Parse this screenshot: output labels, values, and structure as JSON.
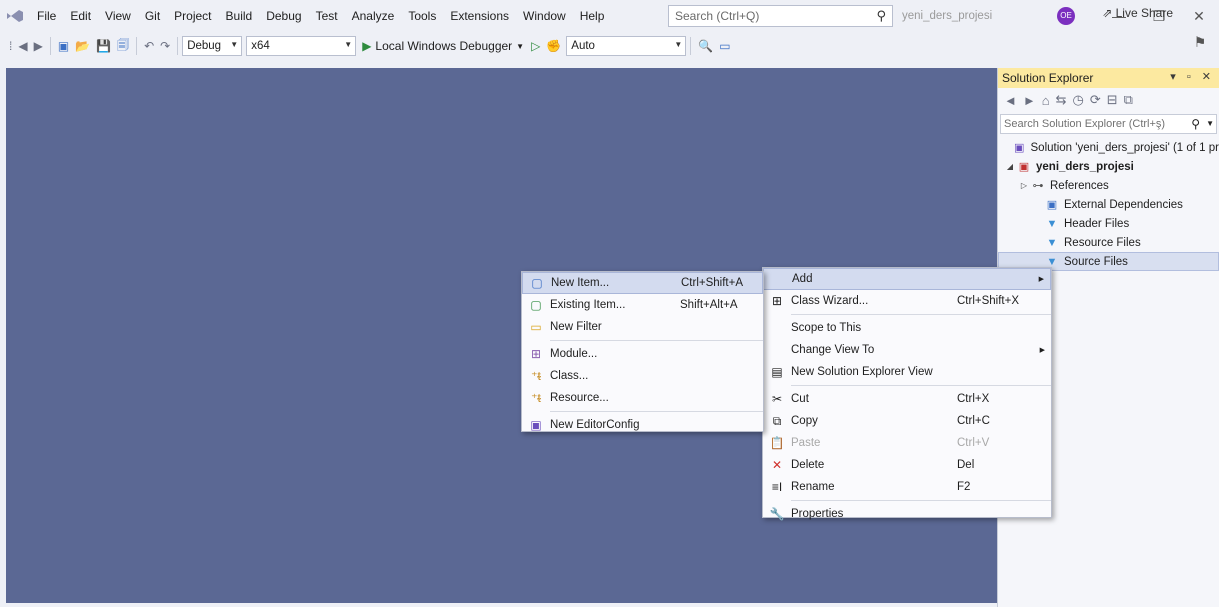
{
  "menubar": {
    "items": [
      "File",
      "Edit",
      "View",
      "Git",
      "Project",
      "Build",
      "Debug",
      "Test",
      "Analyze",
      "Tools",
      "Extensions",
      "Window",
      "Help"
    ],
    "search_placeholder": "Search (Ctrl+Q)",
    "solution_name": "yeni_ders_projesi",
    "avatar_initials": "OE"
  },
  "toolbar": {
    "config": "Debug",
    "platform": "x64",
    "debugger_label": "Local Windows Debugger",
    "target": "Auto",
    "live_share": "Live Share"
  },
  "solution_explorer": {
    "title": "Solution Explorer",
    "search_placeholder": "Search Solution Explorer (Ctrl+ş)",
    "tree": [
      {
        "label": "Solution 'yeni_ders_projesi' (1 of 1 pr",
        "icon": "solution-icon",
        "expander": "",
        "indent": 0
      },
      {
        "label": "yeni_ders_projesi",
        "icon": "project-icon",
        "expander": "◢",
        "indent": 1
      },
      {
        "label": "References",
        "icon": "references-icon",
        "expander": "▷",
        "indent": 2
      },
      {
        "label": "External Dependencies",
        "icon": "external-deps-icon",
        "expander": "",
        "indent": 2
      },
      {
        "label": "Header Files",
        "icon": "filter-folder-icon",
        "expander": "",
        "indent": 2
      },
      {
        "label": "Resource Files",
        "icon": "filter-folder-icon",
        "expander": "",
        "indent": 2
      },
      {
        "label": "Source Files",
        "icon": "filter-folder-icon",
        "expander": "",
        "indent": 2
      }
    ]
  },
  "context_menu": {
    "add": "Add",
    "class_wizard": "Class Wizard...",
    "class_wizard_sc": "Ctrl+Shift+X",
    "scope": "Scope to This",
    "change_view": "Change View To",
    "new_view": "New Solution Explorer View",
    "cut": "Cut",
    "cut_sc": "Ctrl+X",
    "copy": "Copy",
    "copy_sc": "Ctrl+C",
    "paste": "Paste",
    "paste_sc": "Ctrl+V",
    "delete": "Delete",
    "delete_sc": "Del",
    "rename": "Rename",
    "rename_sc": "F2",
    "properties": "Properties"
  },
  "add_submenu": {
    "new_item": "New Item...",
    "new_item_sc": "Ctrl+Shift+A",
    "existing_item": "Existing Item...",
    "existing_item_sc": "Shift+Alt+A",
    "new_filter": "New Filter",
    "module": "Module...",
    "class": "Class...",
    "resource": "Resource...",
    "editorconfig": "New EditorConfig"
  }
}
